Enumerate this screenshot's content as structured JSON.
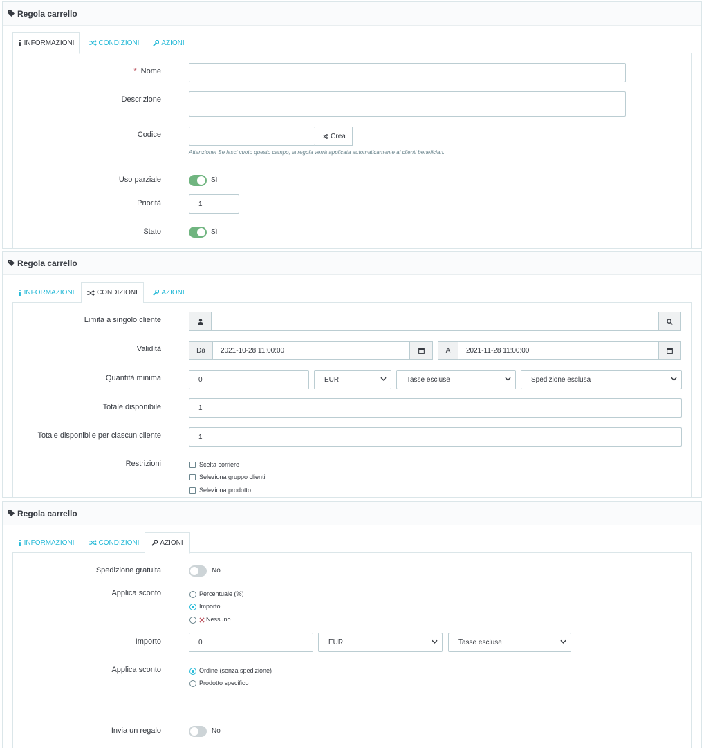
{
  "icons": {
    "panel_icon": "tag-icon",
    "tab_info_icon": "info-icon",
    "tab_conditions_icon": "shuffle-icon",
    "tab_actions_icon": "wrench-icon"
  },
  "colors": {
    "accent": "#25b9d7",
    "switch_on": "#70b580",
    "required": "#c05c67"
  },
  "tabs": {
    "info": "INFORMAZIONI",
    "conditions": "CONDIZIONI",
    "actions": "AZIONI"
  },
  "panel1": {
    "title": "Regola carrello",
    "active_tab": "info",
    "name_label": "Nome",
    "name_required_mark": "*",
    "name_value": "",
    "description_label": "Descrizione",
    "description_value": "",
    "code_label": "Codice",
    "code_value": "",
    "generate_button": "Crea",
    "code_hint": "Attenzione! Se lasci vuoto questo campo, la regola verrà applicata automaticamente ai clienti beneficiari.",
    "partial_use_label": "Uso parziale",
    "partial_use_value": "Sì",
    "priority_label": "Priorità",
    "priority_value": "1",
    "status_label": "Stato",
    "status_value": "Sì"
  },
  "panel2": {
    "title": "Regola carrello",
    "active_tab": "conditions",
    "customer_label": "Limita a singolo cliente",
    "customer_value": "",
    "validity_label": "Validità",
    "from_addon": "Da",
    "from_value": "2021-10-28 11:00:00",
    "to_addon": "A",
    "to_value": "2021-11-28 11:00:00",
    "min_amount_label": "Quantità minima",
    "min_amount_value": "0",
    "currency_selected": "EUR",
    "tax_selected": "Tasse escluse",
    "shipping_selected": "Spedizione esclusa",
    "total_available_label": "Totale disponibile",
    "total_available_value": "1",
    "per_customer_label": "Totale disponibile per ciascun cliente",
    "per_customer_value": "1",
    "restrictions_label": "Restrizioni",
    "restrictions": [
      "Scelta corriere",
      "Seleziona gruppo clienti",
      "Seleziona prodotto"
    ]
  },
  "panel3": {
    "title": "Regola carrello",
    "active_tab": "actions",
    "free_shipping_label": "Spedizione gratuita",
    "free_shipping_value": "No",
    "apply_discount_label": "Applica sconto",
    "discount_options": [
      "Percentuale (%)",
      "Importo",
      "Nessuno"
    ],
    "discount_selected": "Importo",
    "amount_label": "Importo",
    "amount_value": "0",
    "amount_currency": "EUR",
    "amount_tax": "Tasse escluse",
    "apply_to_label": "Applica sconto",
    "apply_to_options": [
      "Ordine (senza spedizione)",
      "Prodotto specifico"
    ],
    "apply_to_selected": "Ordine (senza spedizione)",
    "gift_label": "Invia un regalo",
    "gift_value": "No"
  }
}
